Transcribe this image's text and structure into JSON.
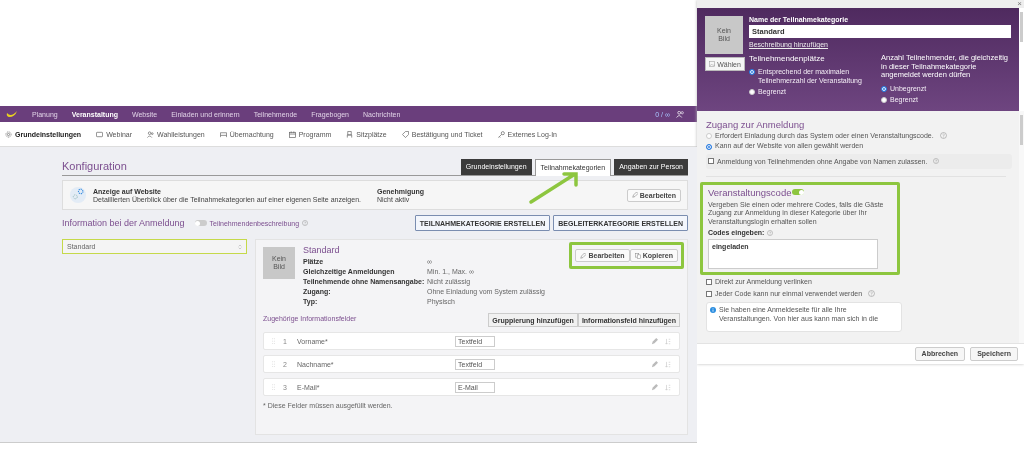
{
  "nav": {
    "items": [
      {
        "label": "Planung",
        "selected": false
      },
      {
        "label": "Veranstaltung",
        "selected": true
      },
      {
        "label": "Website",
        "selected": false
      },
      {
        "label": "Einladen und erinnern",
        "selected": false
      },
      {
        "label": "Teilnehmende",
        "selected": false
      },
      {
        "label": "Fragebogen",
        "selected": false
      },
      {
        "label": "Nachrichten",
        "selected": false
      }
    ],
    "counter": "0 / ∞"
  },
  "subnav": {
    "items": [
      {
        "label": "Grundeinstellungen",
        "selected": true
      },
      {
        "label": "Webinar",
        "selected": false
      },
      {
        "label": "Wahlleistungen",
        "selected": false
      },
      {
        "label": "Übernachtung",
        "selected": false
      },
      {
        "label": "Programm",
        "selected": false
      },
      {
        "label": "Sitzplätze",
        "selected": false
      },
      {
        "label": "Bestätigung und Ticket",
        "selected": false
      },
      {
        "label": "Externes Log-In",
        "selected": false
      }
    ]
  },
  "config": {
    "title": "Konfiguration",
    "tabs": [
      {
        "label": "Grundeinstellungen",
        "selected": false
      },
      {
        "label": "Teilnahmekategorien",
        "selected": true
      },
      {
        "label": "Angaben zur Person",
        "selected": false
      }
    ]
  },
  "website_card": {
    "title": "Anzeige auf Website",
    "description": "Detaillierten Überblick über die Teilnahmekategorien auf einer eigenen Seite anzeigen.",
    "approval_label": "Genehmigung",
    "approval_value": "Nicht aktiv",
    "edit_button": "Bearbeiten"
  },
  "registration_info": {
    "title": "Information bei der Anmeldung",
    "toggle_label": "Teilnehmendenbeschreibung",
    "on": false
  },
  "create_buttons": [
    "TEILNAHMEKATEGORIE ERSTELLEN",
    "BEGLEITERKATEGORIE ERSTELLEN"
  ],
  "category_list": [
    {
      "label": "Standard",
      "selected": true
    }
  ],
  "category": {
    "image_placeholder": "Kein Bild",
    "title": "Standard",
    "details": [
      {
        "label": "Plätze",
        "value": "∞"
      },
      {
        "label": "Gleichzeitige Anmeldungen",
        "value": "Min. 1., Max. ∞"
      },
      {
        "label": "Teilnehmende ohne Namensangabe:",
        "value": "Nicht zulässig"
      },
      {
        "label": "Zugang:",
        "value": "Ohne Einladung vom System zulässig"
      },
      {
        "label": "Typ:",
        "value": "Physisch"
      }
    ],
    "buttons": [
      "Bearbeiten",
      "Kopieren"
    ],
    "fields_title": "Zugehörige Informationsfelder",
    "field_buttons": [
      "Gruppierung hinzufügen",
      "Informationsfeld hinzufügen"
    ],
    "fields": [
      {
        "number": "1",
        "name": "Vorname*",
        "type": "Textfeld"
      },
      {
        "number": "2",
        "name": "Nachname*",
        "type": "Textfeld"
      },
      {
        "number": "3",
        "name": "E-Mail*",
        "type": "E-Mail"
      }
    ],
    "footnote": "* Diese Felder müssen ausgefüllt werden."
  },
  "dialog": {
    "close": "×",
    "image_placeholder": "Kein Bild",
    "choose_button": "Wählen",
    "name_label": "Name der Teilnahmekategorie",
    "name_value": "Standard",
    "description_link": "Beschreibung hinzufügen",
    "seats": {
      "title": "Teilnehmendenplätze",
      "options": [
        {
          "label": "Entsprechend der maximalen Teilnehmerzahl der Veranstaltung",
          "selected": true
        },
        {
          "label": "Begrenzt",
          "selected": false
        }
      ]
    },
    "concurrent": {
      "title": "Anzahl Teilnehmender, die gleichzeitig in dieser Teilnahmekategorie angemeldet werden dürfen",
      "options": [
        {
          "label": "Unbegrenzt",
          "selected": true
        },
        {
          "label": "Begrenzt",
          "selected": false
        }
      ]
    },
    "access": {
      "title": "Zugang zur Anmeldung",
      "options": [
        {
          "label": "Erfordert Einladung durch das System oder einen Veranstaltungscode.",
          "selected": false,
          "help": true
        },
        {
          "label": "Kann auf der Website von allen gewählt werden",
          "selected": true,
          "help": false
        }
      ],
      "anonymous": {
        "label": "Anmeldung von Teilnehmenden ohne Angabe von Namen zulassen.",
        "checked": false
      }
    },
    "event_code": {
      "title": "Veranstaltungscode",
      "on": true,
      "description": "Vergeben Sie einen oder mehrere Codes, falls die Gäste Zugang zur Anmeldung in dieser Kategorie über Ihr Veranstaltungslogin erhalten sollen",
      "codes_label": "Codes eingeben:",
      "codes_value": "eingeladen",
      "options": [
        {
          "label": "Direkt zur Anmeldung verlinken",
          "checked": false,
          "help": false
        },
        {
          "label": "Jeder Code kann nur einmal verwendet werden",
          "checked": false,
          "help": true
        }
      ],
      "info": "Sie haben eine Anmeldeseite für alle Ihre Veranstaltungen. Von hier aus kann man sich in die"
    },
    "buttons": [
      "Abbrechen",
      "Speichern"
    ]
  }
}
